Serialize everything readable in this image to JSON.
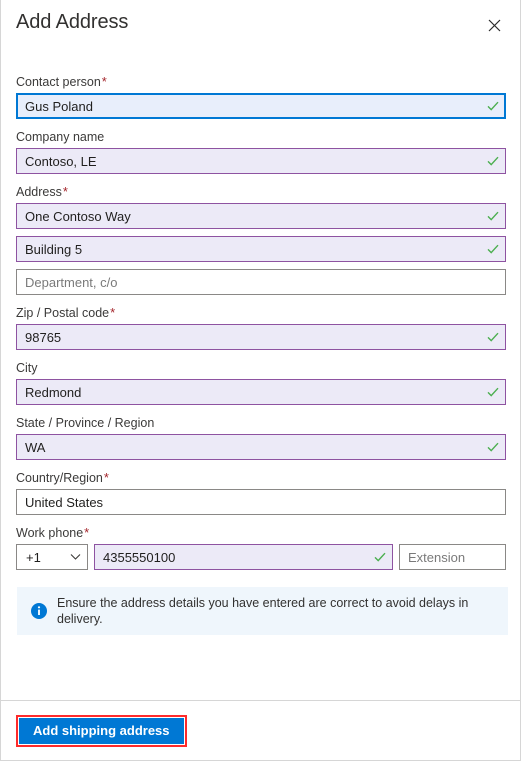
{
  "dialog": {
    "title": "Add Address",
    "close_label": "Close",
    "close_icon": "close-icon"
  },
  "colors": {
    "accent": "#0078d4",
    "focus_border": "#0078d4",
    "valid_border": "#8e53a1",
    "valid_fill": "#eceaf7",
    "required_mark": "#a4262c",
    "check": "#4caf50",
    "info_background": "#eff6fc",
    "highlight_outline": "#ff2b2b",
    "neutral_border": "#8a8886"
  },
  "form": {
    "required_marker": "*",
    "fields": [
      {
        "label": "Contact person",
        "required": true,
        "value": "Gus Poland",
        "placeholder": "",
        "state": "focused",
        "valid": true,
        "name": "contact-person"
      },
      {
        "label": "Company name",
        "required": false,
        "value": "Contoso, LE",
        "placeholder": "",
        "state": "valid",
        "valid": true,
        "name": "company-name"
      },
      {
        "label": "Address",
        "required": true,
        "value": "One Contoso Way",
        "placeholder": "",
        "state": "valid",
        "valid": true,
        "name": "address-line-1"
      },
      {
        "label": "",
        "required": false,
        "value": "Building 5",
        "placeholder": "",
        "state": "valid",
        "valid": true,
        "name": "address-line-2"
      },
      {
        "label": "",
        "required": false,
        "value": "",
        "placeholder": "Department, c/o",
        "state": "empty",
        "valid": false,
        "name": "address-line-3-department"
      },
      {
        "label": "Zip / Postal code",
        "required": true,
        "value": "98765",
        "placeholder": "",
        "state": "valid",
        "valid": true,
        "name": "zip-postal-code"
      },
      {
        "label": "City",
        "required": false,
        "value": "Redmond",
        "placeholder": "",
        "state": "valid",
        "valid": true,
        "name": "city"
      },
      {
        "label": "State / Province / Region",
        "required": false,
        "value": "WA",
        "placeholder": "",
        "state": "valid",
        "valid": true,
        "name": "state-province-region"
      },
      {
        "label": "Country/Region",
        "required": true,
        "value": "United States",
        "placeholder": "",
        "state": "plain",
        "valid": false,
        "name": "country-region"
      }
    ],
    "phone": {
      "label": "Work phone",
      "required": true,
      "country_code": "+1",
      "country_code_icon": "chevron-down-icon",
      "number": "4355550100",
      "number_valid": true,
      "extension_value": "",
      "extension_placeholder": "Extension"
    }
  },
  "info": {
    "icon": "info-circle-icon",
    "message": "Ensure the address details you have entered are correct to avoid delays in delivery."
  },
  "footer": {
    "submit_label": "Add shipping address"
  }
}
